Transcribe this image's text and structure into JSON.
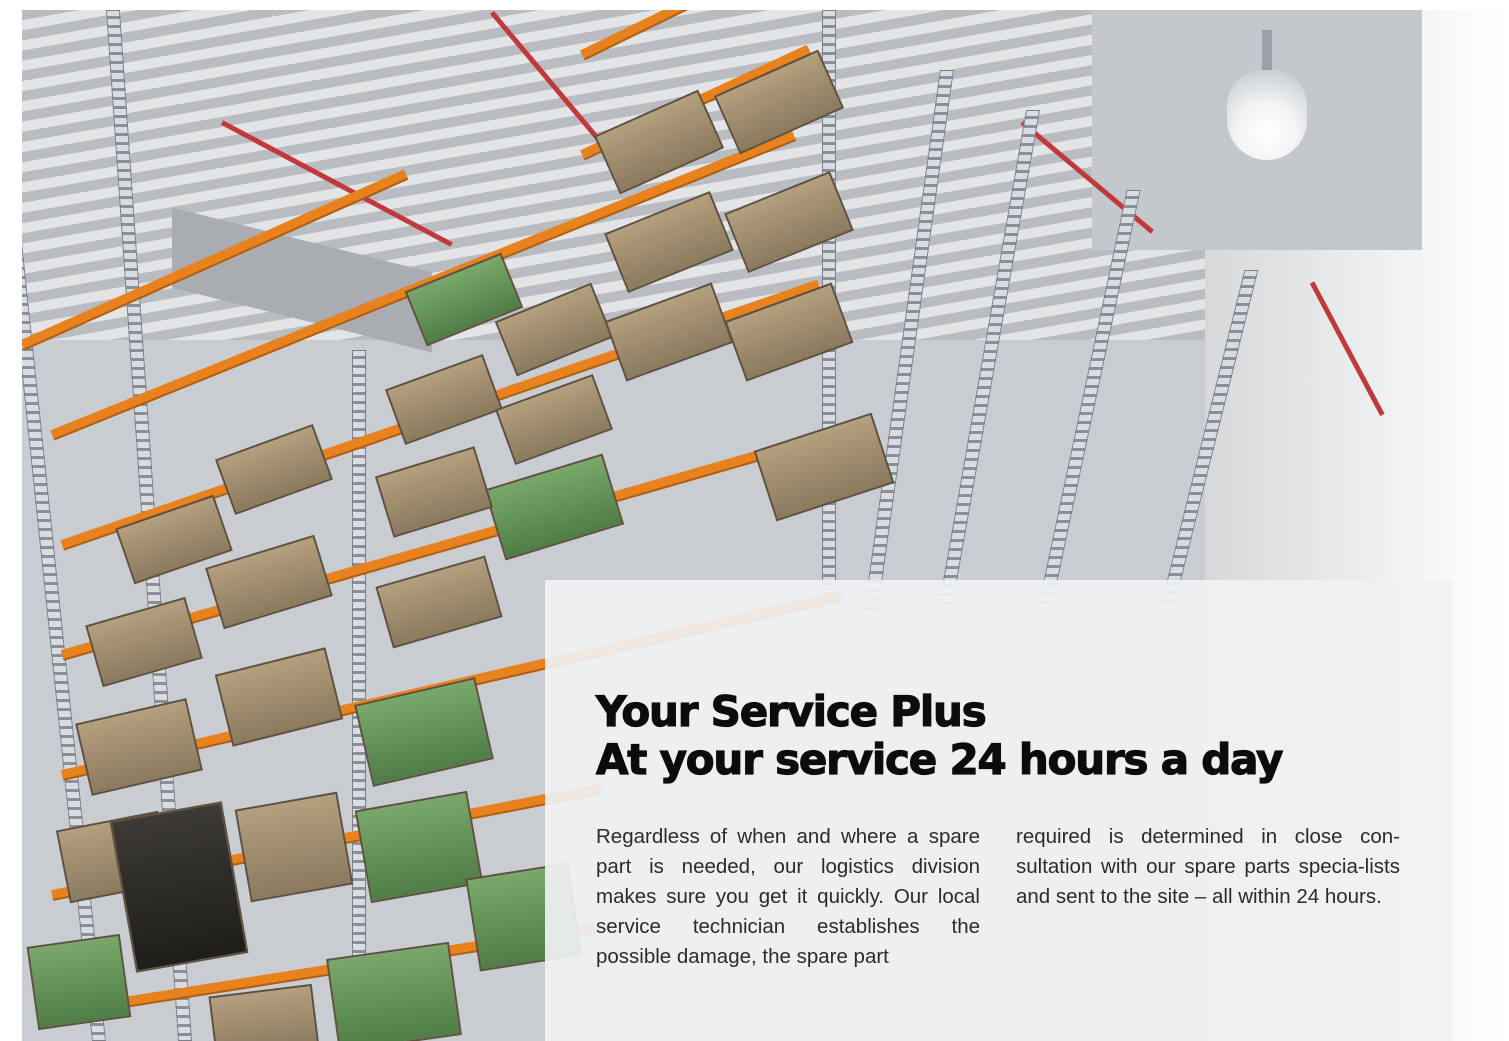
{
  "article": {
    "title_line1": "Your Service Plus",
    "title_line2": "At your service 24 hours a day",
    "body_col1": "Regardless of when and where a spare part is needed, our logistics division makes sure you get it quickly. Our local service technician establishes the possible damage, the spare part",
    "body_col2": "required is determined in close con-sultation with our spare parts specia-lists and sent to the site – all within 24 hours."
  },
  "colors": {
    "shelf_beam": "#e8821f",
    "panel_background": "#f0f1f2",
    "heading_text": "#0c0c0c"
  }
}
